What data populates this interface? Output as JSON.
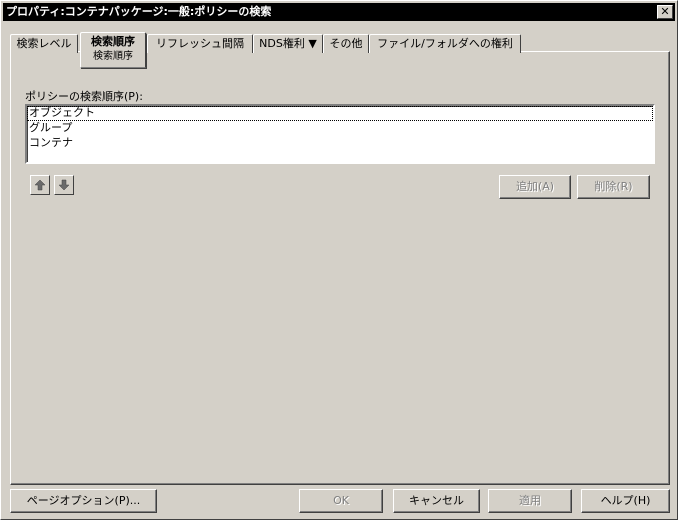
{
  "window": {
    "title": "プロパティ:コンテナパッケージ:一般:ポリシーの検索",
    "close_label": "✕"
  },
  "tabs": [
    {
      "label": "検索レベル"
    },
    {
      "label": "検索順序",
      "sub_label": "検索順序"
    },
    {
      "label": "リフレッシュ間隔"
    },
    {
      "label": "NDS権利 ▼"
    },
    {
      "label": "その他"
    },
    {
      "label": "ファイル/フォルダへの権利"
    }
  ],
  "search_order": {
    "label": "ポリシーの検索順序(P):",
    "items": [
      "オブジェクト",
      "グループ",
      "コンテナ"
    ],
    "move_up_icon": "up-arrow-icon",
    "move_down_icon": "down-arrow-icon",
    "add_label": "追加(A)",
    "delete_label": "削除(R)"
  },
  "footer": {
    "page_options_label": "ページオプション(P)...",
    "ok_label": "OK",
    "cancel_label": "キャンセル",
    "apply_label": "適用",
    "help_label": "ヘルプ(H)"
  },
  "colors": {
    "face": "#d4d0c8",
    "titlebar": "#000000",
    "disabled_text": "#808080"
  }
}
